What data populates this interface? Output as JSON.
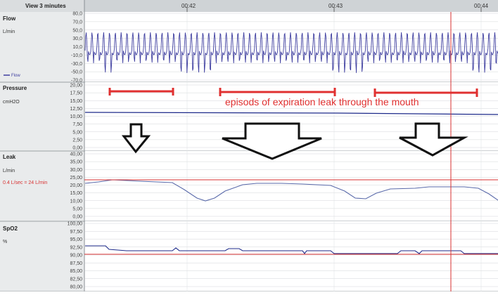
{
  "header": {
    "title": "View 3 minutes",
    "time_labels": [
      "00:42",
      "00:43",
      "00:44"
    ]
  },
  "panels": [
    {
      "key": "flow",
      "title": "Flow",
      "unit": "L/min",
      "legend": "Flow",
      "ticks": [
        "80,0",
        "70,0",
        "50,0",
        "30,0",
        "10,0",
        "-10,0",
        "-30,0",
        "-50,0",
        "-70,0"
      ]
    },
    {
      "key": "pressure",
      "title": "Pressure",
      "unit": "cmH2O",
      "ticks": [
        "20,00",
        "17,50",
        "15,00",
        "12,50",
        "10,00",
        "7,50",
        "5,00",
        "2,50",
        "0,00"
      ]
    },
    {
      "key": "leak",
      "title": "Leak",
      "unit": "L/min",
      "note": "0.4 L/sec = 24 L/min",
      "ticks": [
        "40,00",
        "35,00",
        "30,00",
        "25,00",
        "20,00",
        "15,00",
        "10,00",
        "5,00",
        "0,00"
      ]
    },
    {
      "key": "spo2",
      "title": "SpO2",
      "unit": "%",
      "ticks": [
        "100,00",
        "97,50",
        "95,00",
        "92,50",
        "90,00",
        "87,50",
        "85,00",
        "82,50",
        "80,00"
      ]
    }
  ],
  "annotation": {
    "text": "episods of expiration leak through the mouth"
  },
  "colors": {
    "header_bg": "#cfd3d6",
    "left_bg": "#e9ebec",
    "flow_trace": "#3f3fa0",
    "pressure_trace": "#1d2a8a",
    "leak_trace": "#5a6aaa",
    "spo2_trace": "#1d2a8a",
    "reference_line": "#d83232",
    "annotation_red": "#e03030",
    "grid": "#c8ccd0"
  }
}
